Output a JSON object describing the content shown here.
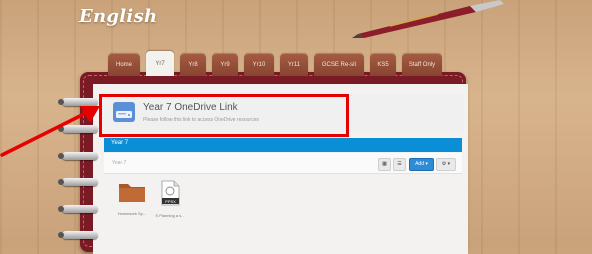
{
  "header": {
    "site_title": "English"
  },
  "tabs": [
    {
      "label": "Home"
    },
    {
      "label": "Yr7",
      "active": true
    },
    {
      "label": "Yr8"
    },
    {
      "label": "Yr9"
    },
    {
      "label": "Yr10"
    },
    {
      "label": "Yr11"
    },
    {
      "label": "GCSE Re-sit"
    },
    {
      "label": "KS5"
    },
    {
      "label": "Staff Only"
    }
  ],
  "onedrive_card": {
    "title": "Year 7 OneDrive Link",
    "description": "Please follow this link to access OneDrive resources"
  },
  "folder_panel": {
    "title": "Year 7",
    "breadcrumb": "Year 7",
    "add_label": "Add",
    "files": [
      {
        "name": "Homework Sp...",
        "icon": "folder-icon"
      },
      {
        "name": "S Planning a s...",
        "icon": "ppsx-file-icon",
        "badge": "PPSX"
      }
    ]
  },
  "colors": {
    "accent_blue": "#0a8fd6",
    "tab_brown": "#8f4a35",
    "binder": "#7a1a25",
    "highlight": "#e60000"
  }
}
